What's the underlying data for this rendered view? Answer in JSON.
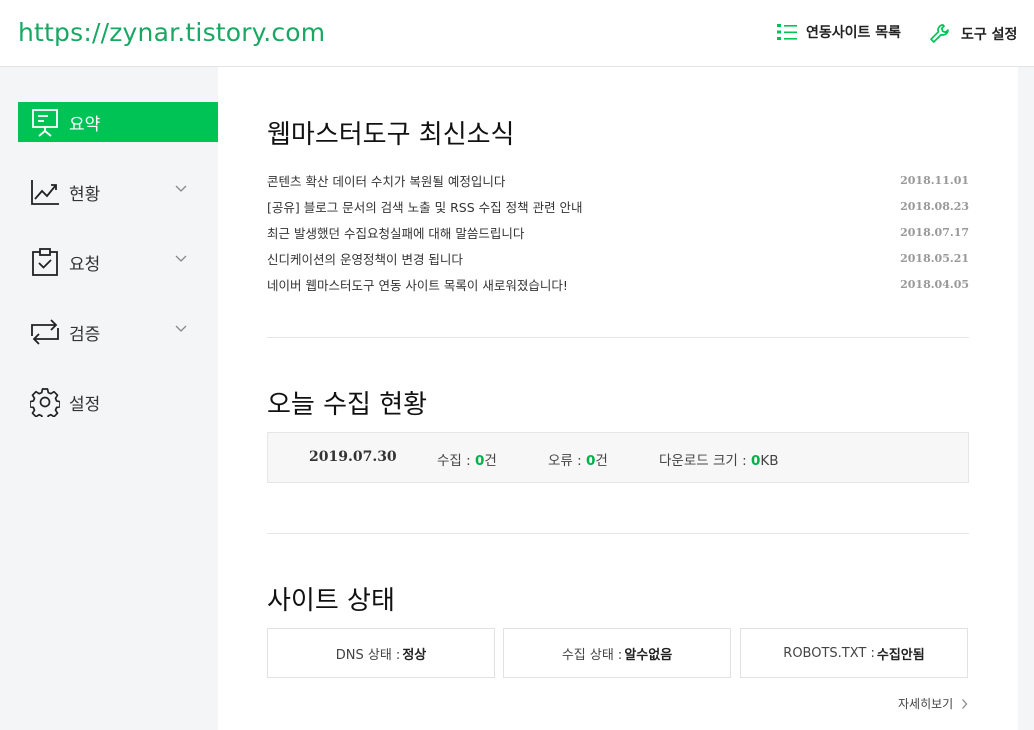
{
  "header": {
    "site_url": "https://zynar.tistory.com",
    "linked_sites_label": "연동사이트 목록",
    "tool_settings_label": "도구 설정"
  },
  "sidebar": {
    "items": [
      {
        "label": "요약",
        "icon": "presentation-board-icon",
        "active": true
      },
      {
        "label": "현황",
        "icon": "line-chart-icon",
        "expandable": true
      },
      {
        "label": "요청",
        "icon": "clipboard-check-icon",
        "expandable": true
      },
      {
        "label": "검증",
        "icon": "swap-arrows-icon",
        "expandable": true
      },
      {
        "label": "설정",
        "icon": "gear-icon"
      }
    ]
  },
  "news": {
    "title": "웹마스터도구 최신소식",
    "items": [
      {
        "text": "콘텐츠 확산 데이터 수치가 복원될 예정입니다",
        "date": "2018.11.01"
      },
      {
        "text": "[공유] 블로그 문서의 검색 노출 및 RSS 수집 정책 관련 안내",
        "date": "2018.08.23"
      },
      {
        "text": "최근 발생했던 수집요청실패에 대해 말씀드립니다",
        "date": "2018.07.17"
      },
      {
        "text": "신디케이션의 운영정책이 변경 됩니다",
        "date": "2018.05.21"
      },
      {
        "text": "네이버 웹마스터도구 연동 사이트 목록이 새로워졌습니다!",
        "date": "2018.04.05"
      }
    ]
  },
  "today": {
    "title": "오늘 수집 현황",
    "date": "2019.07.30",
    "collect_label": "수집 : ",
    "collect_value": "0",
    "collect_unit": "건",
    "error_label": "오류 : ",
    "error_value": "0",
    "error_unit": "건",
    "download_label": "다운로드 크기 : ",
    "download_value": "0",
    "download_unit": "KB"
  },
  "site_status": {
    "title": "사이트 상태",
    "dns_label": "DNS 상태 : ",
    "dns_value": "정상",
    "collect_label": "수집 상태 : ",
    "collect_value": "알수없음",
    "robots_label": "ROBOTS.TXT : ",
    "robots_value": "수집안됨",
    "more_label": "자세히보기"
  },
  "colors": {
    "accent": "#00c356",
    "url": "#19a863",
    "number": "#00b24a"
  }
}
